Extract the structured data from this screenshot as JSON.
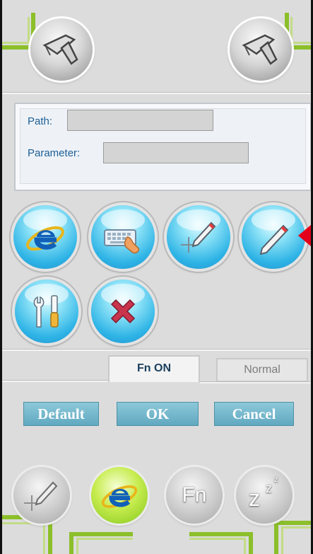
{
  "fields": {
    "path_label": "Path:",
    "path_value": "",
    "parameter_label": "Parameter:",
    "parameter_value": ""
  },
  "icons": {
    "top_left": "barcode-scanner-icon",
    "top_right": "barcode-scanner-icon",
    "row1": [
      "internet-explorer-icon",
      "keyboard-touch-icon",
      "pen-crosshair-icon",
      "pen-icon"
    ],
    "row2": [
      "tools-icon",
      "close-icon"
    ],
    "bottom": [
      "pen-crosshair-icon",
      "internet-explorer-icon",
      "fn-icon",
      "sleep-icon"
    ]
  },
  "tabs": {
    "fn_on": "Fn ON",
    "normal": "Normal"
  },
  "buttons": {
    "default": "Default",
    "ok": "OK",
    "cancel": "Cancel"
  },
  "bottom": {
    "fn_glyph": "Fn",
    "sleep_glyph": "z"
  },
  "colors": {
    "accent_green": "#8cbf2a",
    "orb_blue": "#2fb4e6",
    "button_blue": "#6cb5cc",
    "pointer_red": "#e2001a",
    "label_blue": "#1d5f96"
  }
}
